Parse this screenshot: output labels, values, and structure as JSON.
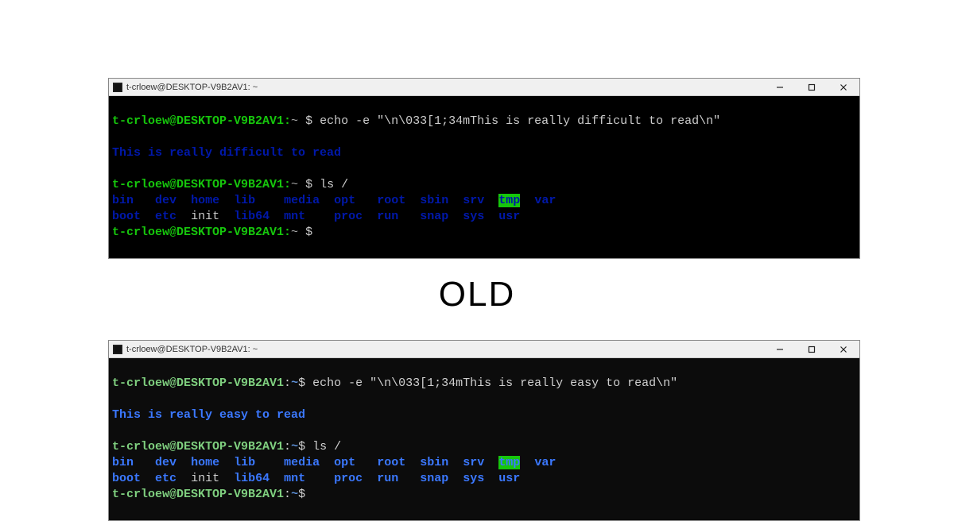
{
  "label": "OLD",
  "old": {
    "title": "t-crloew@DESKTOP-V9B2AV1: ~",
    "prompt_user": "t-crloew@DESKTOP-V9B2AV1:",
    "prompt_path": "~",
    "dollar_sp": "$ ",
    "cmd1": "echo -e \"\\n\\033[1;34mThis is really difficult to read\\n\"",
    "output1": "This is really difficult to read",
    "cmd2": "ls /",
    "ls_row1": {
      "c0": "bin",
      "c1": "dev",
      "c2": "home",
      "c3": "lib",
      "c4": "media",
      "c5": "opt",
      "c6": "root",
      "c7": "sbin",
      "c8": "srv",
      "c9": "tmp",
      "c10": "var"
    },
    "ls_row2": {
      "c0": "boot",
      "c1": "etc",
      "c2": "init",
      "c3": "lib64",
      "c4": "mnt",
      "c5": "proc",
      "c6": "run",
      "c7": "snap",
      "c8": "sys",
      "c9": "usr"
    },
    "final_dollar": "$ "
  },
  "new": {
    "title": "t-crloew@DESKTOP-V9B2AV1: ~",
    "prompt_userhost": "t-crloew@DESKTOP-V9B2AV1",
    "colon": ":",
    "path": "~",
    "dollar_sp": "$ ",
    "cmd1": "echo -e \"\\n\\033[1;34mThis is really easy to read\\n\"",
    "output1": "This is really easy to read",
    "cmd2": "ls /",
    "ls_row1": {
      "c0": "bin",
      "c1": "dev",
      "c2": "home",
      "c3": "lib",
      "c4": "media",
      "c5": "opt",
      "c6": "root",
      "c7": "sbin",
      "c8": "srv",
      "c9": "tmp",
      "c10": "var"
    },
    "ls_row2": {
      "c0": "boot",
      "c1": "etc",
      "c2": "init",
      "c3": "lib64",
      "c4": "mnt",
      "c5": "proc",
      "c6": "run",
      "c7": "snap",
      "c8": "sys",
      "c9": "usr"
    },
    "final_dollar": "$"
  },
  "colors": {
    "old_blue": "#0018aa",
    "new_blue": "#3b78ff",
    "green": "#16c60c",
    "term_bg_old": "#000000",
    "term_bg_new": "#0c0c0c"
  }
}
